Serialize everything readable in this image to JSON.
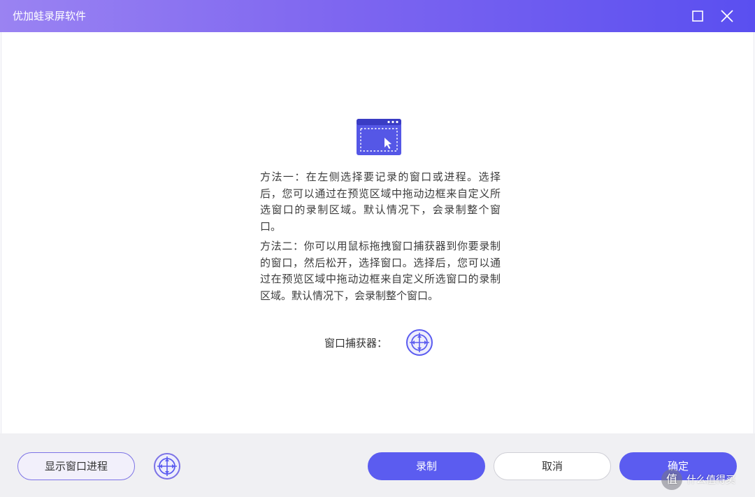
{
  "window": {
    "title": "优加蛙录屏软件",
    "maximize_icon": "maximize-icon",
    "close_icon": "close-icon"
  },
  "content": {
    "hero_icon": "window-select-icon",
    "method_one": "方法一：在左侧选择要记录的窗口或进程。选择后，您可以通过在预览区域中拖动边框来自定义所选窗口的录制区域。默认情况下，会录制整个窗口。",
    "method_two": "方法二：你可以用鼠标拖拽窗口捕获器到你要录制的窗口，然后松开，选择窗口。选择后，您可以通过在预览区域中拖动边框来自定义所选窗口的录制区域。默认情况下，会录制整个窗口。",
    "catcher_label": "窗口捕获器：",
    "catcher_icon": "crosshair-target-icon"
  },
  "footer": {
    "show_process_label": "显示窗口进程",
    "record_label": "录制",
    "cancel_label": "取消",
    "ok_label": "确定"
  },
  "watermark": {
    "badge": "值",
    "text": "什么值得买"
  },
  "colors": {
    "title_gradient_start": "#9a83f2",
    "title_gradient_end": "#5a4ff0",
    "primary": "#5b5cf0",
    "outline": "#7c72e6",
    "footer_bg": "#f0f0f3"
  }
}
